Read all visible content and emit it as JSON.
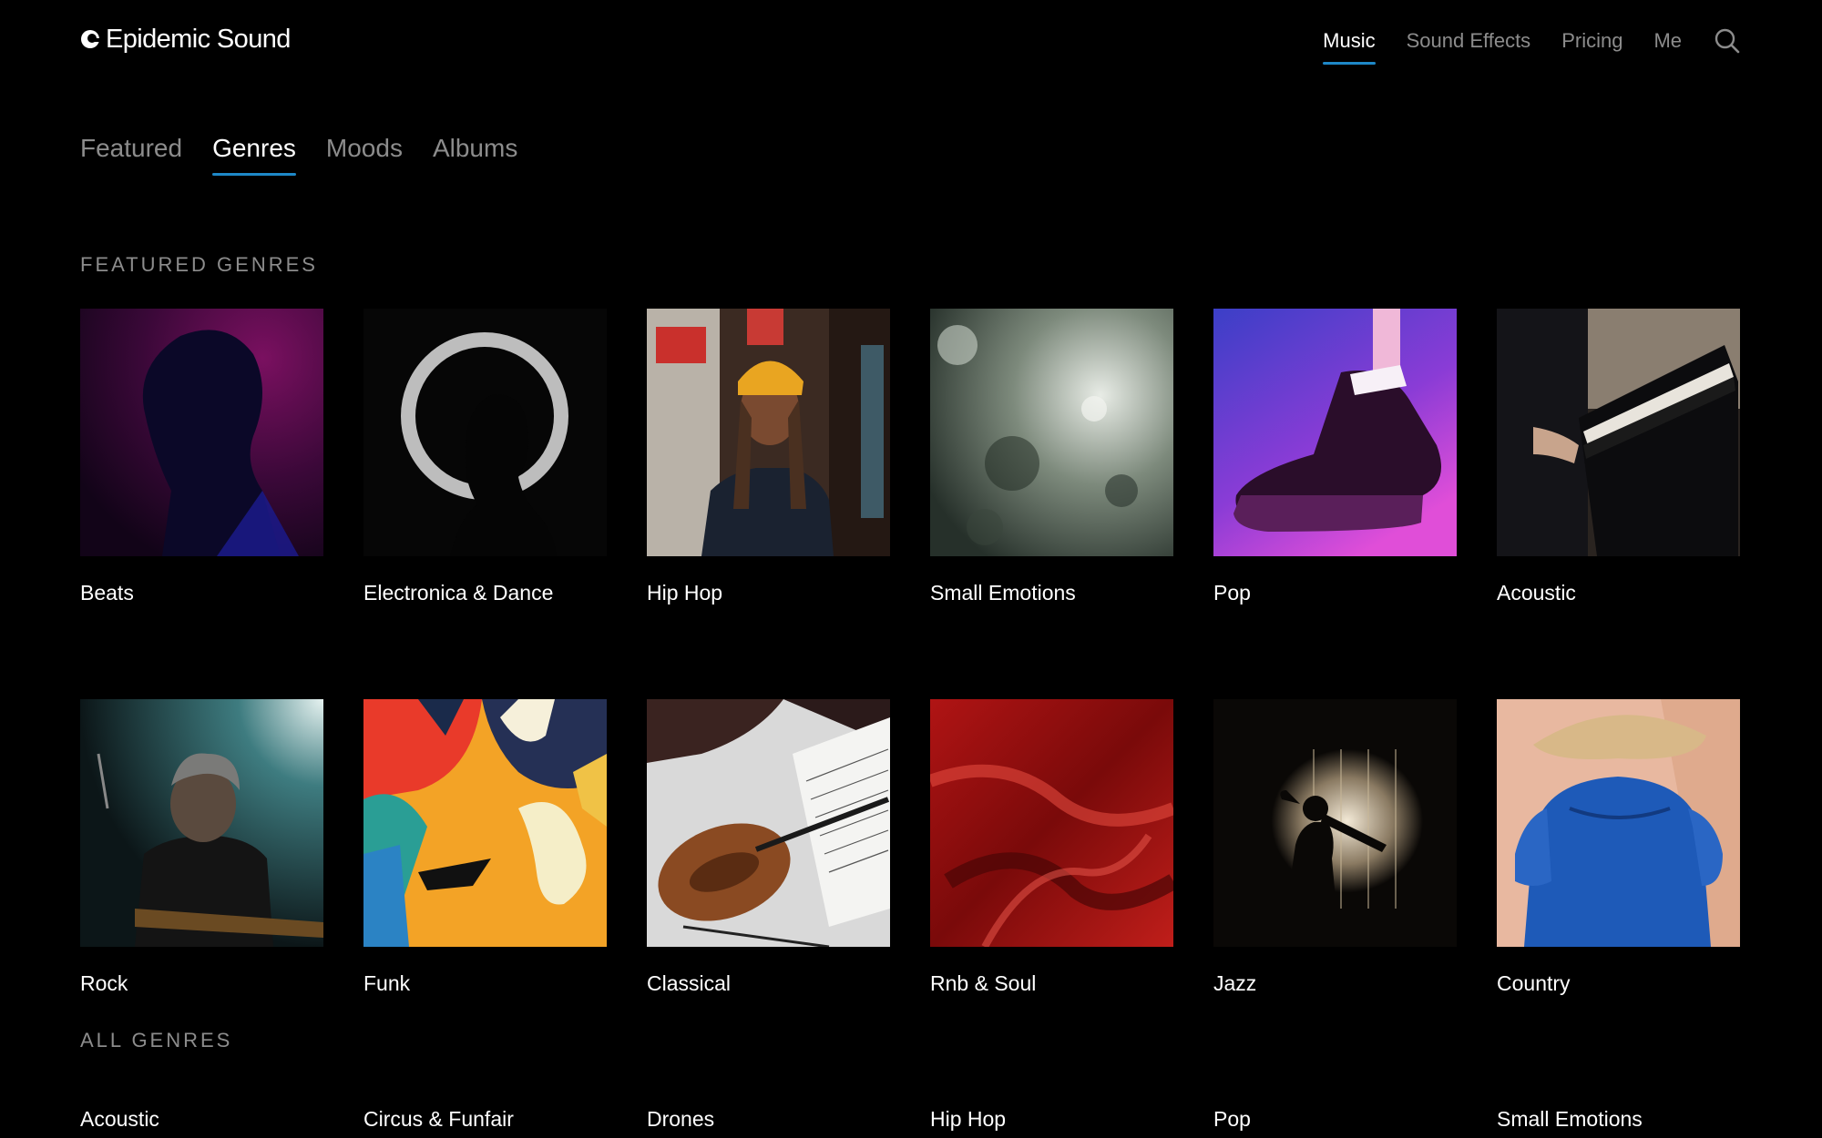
{
  "brand": {
    "name": "Epidemic Sound",
    "logo_icon": "epidemic-logo-icon"
  },
  "topnav": {
    "items": [
      {
        "label": "Music",
        "active": true
      },
      {
        "label": "Sound Effects",
        "active": false
      },
      {
        "label": "Pricing",
        "active": false
      },
      {
        "label": "Me",
        "active": false
      }
    ],
    "search_icon": "search-icon"
  },
  "tabs": [
    {
      "label": "Featured",
      "active": false
    },
    {
      "label": "Genres",
      "active": true
    },
    {
      "label": "Moods",
      "active": false
    },
    {
      "label": "Albums",
      "active": false
    }
  ],
  "featured_genres": {
    "heading": "FEATURED GENRES",
    "items": [
      {
        "label": "Beats"
      },
      {
        "label": "Electronica & Dance"
      },
      {
        "label": "Hip Hop"
      },
      {
        "label": "Small Emotions"
      },
      {
        "label": "Pop"
      },
      {
        "label": "Acoustic"
      },
      {
        "label": "Rock"
      },
      {
        "label": "Funk"
      },
      {
        "label": "Classical"
      },
      {
        "label": "Rnb & Soul"
      },
      {
        "label": "Jazz"
      },
      {
        "label": "Country"
      }
    ]
  },
  "all_genres": {
    "heading": "ALL GENRES",
    "items": [
      {
        "label": "Acoustic"
      },
      {
        "label": "Circus & Funfair"
      },
      {
        "label": "Drones"
      },
      {
        "label": "Hip Hop"
      },
      {
        "label": "Pop"
      },
      {
        "label": "Small Emotions"
      }
    ]
  },
  "colors": {
    "background": "#000000",
    "accent_underline": "#1e88c8",
    "muted_text": "#8c8c8c",
    "primary_text": "#ffffff"
  }
}
